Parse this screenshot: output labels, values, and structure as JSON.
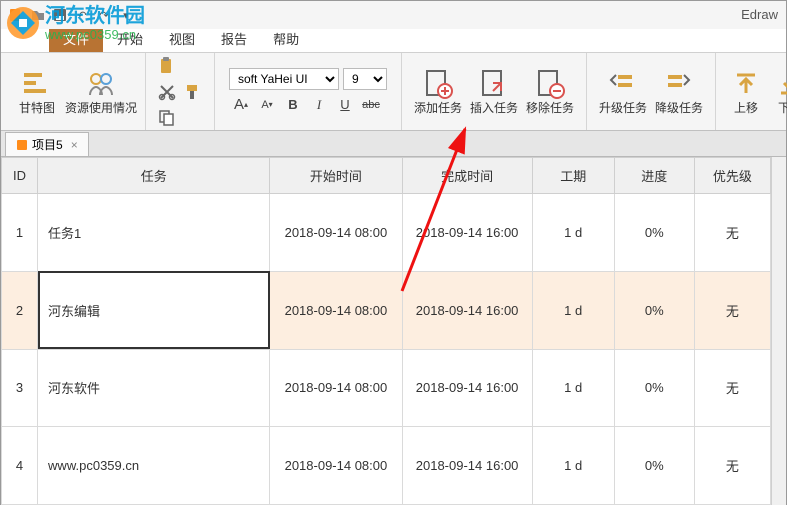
{
  "app_title": "Edraw",
  "watermark": {
    "cn": "河东软件园",
    "en": "www.pc0359.cn"
  },
  "menus": {
    "file": "文件",
    "start": "开始",
    "view": "视图",
    "report": "报告",
    "help": "帮助"
  },
  "ribbon": {
    "gantt": "甘特图",
    "resource": "资源使用情况",
    "font_name": "soft YaHei UI",
    "font_size": "9",
    "inc": "A▲",
    "dec": "A▼",
    "bold": "B",
    "italic": "I",
    "underline": "U",
    "strike": "abc",
    "add_task": "添加任务",
    "insert_task": "插入任务",
    "remove_task": "移除任务",
    "promote": "升级任务",
    "demote": "降级任务",
    "move_up": "上移",
    "move_down": "下移"
  },
  "tab": {
    "name": "项目5",
    "close": "×"
  },
  "headers": {
    "id": "ID",
    "task": "任务",
    "start": "开始时间",
    "end": "完成时间",
    "duration": "工期",
    "progress": "进度",
    "priority": "优先级"
  },
  "rows": [
    {
      "id": "1",
      "task": "任务1",
      "start": "2018-09-14 08:00",
      "end": "2018-09-14 16:00",
      "dur": "1 d",
      "prog": "0%",
      "pri": "无"
    },
    {
      "id": "2",
      "task": "河东编辑",
      "start": "2018-09-14 08:00",
      "end": "2018-09-14 16:00",
      "dur": "1 d",
      "prog": "0%",
      "pri": "无"
    },
    {
      "id": "3",
      "task": "河东软件",
      "start": "2018-09-14 08:00",
      "end": "2018-09-14 16:00",
      "dur": "1 d",
      "prog": "0%",
      "pri": "无"
    },
    {
      "id": "4",
      "task": "www.pc0359.cn",
      "start": "2018-09-14 08:00",
      "end": "2018-09-14 16:00",
      "dur": "1 d",
      "prog": "0%",
      "pri": "无"
    }
  ],
  "icons": {
    "doc": "📄",
    "tab_ico": "📋"
  }
}
